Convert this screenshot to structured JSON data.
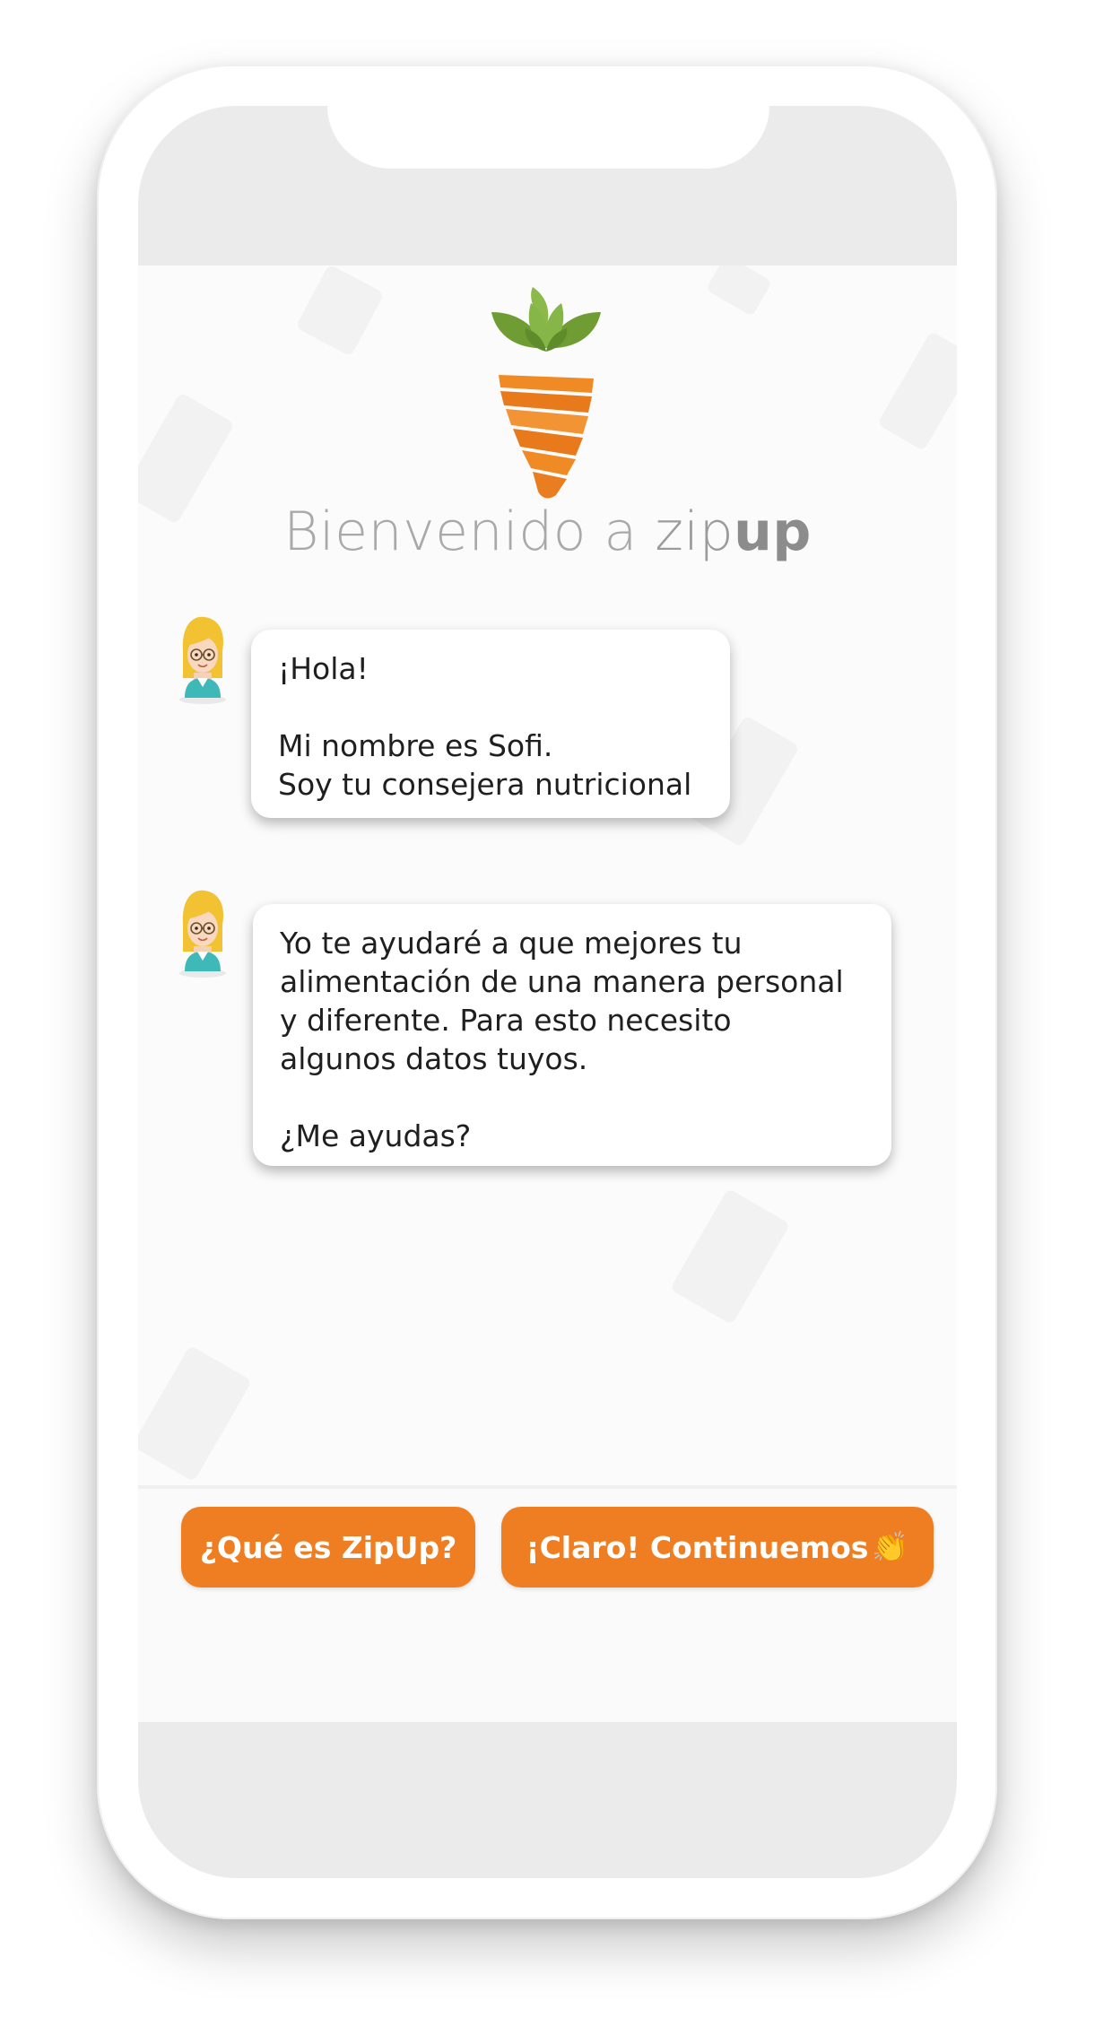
{
  "app": {
    "welcome_prefix": "Bienvenido a ",
    "brand_light": "zip",
    "brand_bold": "up"
  },
  "chat": {
    "messages": [
      {
        "sender": "Sofi",
        "text": "¡Hola!\n\nMi nombre es Sofi.\nSoy tu consejera nutricional"
      },
      {
        "sender": "Sofi",
        "text": "Yo te ayudaré a que mejores tu\nalimentación de una manera personal\ny diferente. Para esto necesito\nalgunos datos tuyos.\n\n¿Me ayudas?"
      }
    ]
  },
  "actions": {
    "what_is_label": "¿Qué es ZipUp?",
    "continue_label": "¡Claro! Continuemos",
    "continue_emoji": "👏"
  },
  "colors": {
    "accent": "#ef7e22",
    "leaf": "#7aab3a",
    "carrot": "#f08a24",
    "title_gray": "#a9a9a9"
  },
  "icons": [
    "carrot-logo-icon",
    "avatar-icon",
    "clapping-hands-icon"
  ]
}
